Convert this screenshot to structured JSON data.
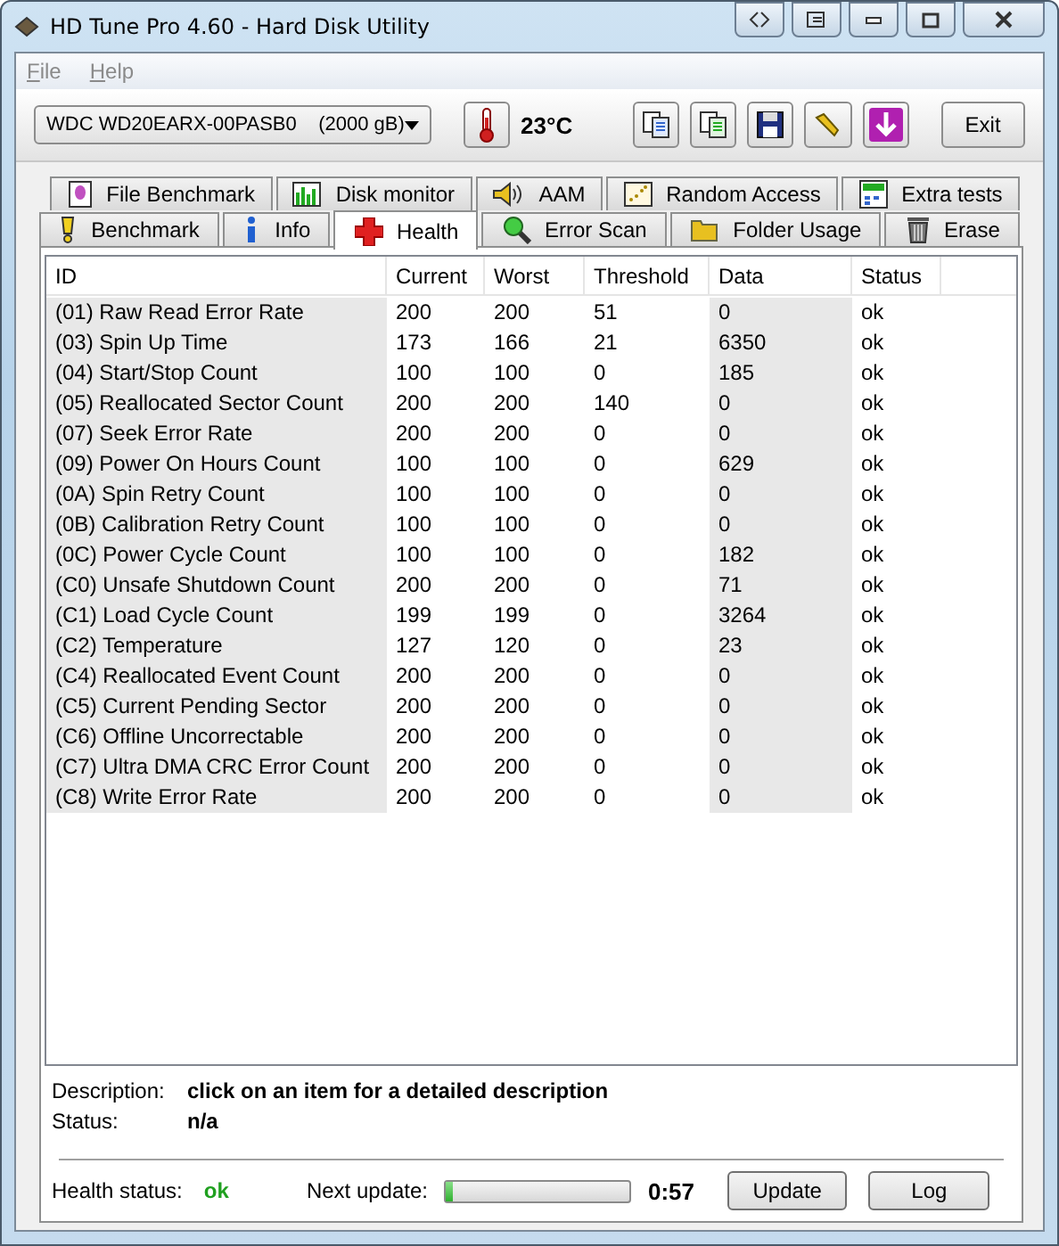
{
  "window": {
    "title": "HD Tune Pro 4.60 - Hard Disk Utility"
  },
  "menu": [
    {
      "label": "File"
    },
    {
      "label": "Help"
    }
  ],
  "toolbar": {
    "drive": "WDC WD20EARX-00PASB0    (2000 gB)",
    "temperature": "23°C",
    "exit": "Exit"
  },
  "tabs": [
    [
      {
        "label": "File Benchmark",
        "selected": false
      },
      {
        "label": "Disk monitor",
        "selected": false
      },
      {
        "label": "AAM",
        "selected": false
      },
      {
        "label": "Random Access",
        "selected": false
      },
      {
        "label": "Extra tests",
        "selected": false
      }
    ],
    [
      {
        "label": "Benchmark",
        "selected": false
      },
      {
        "label": "Info",
        "selected": false
      },
      {
        "label": "Health",
        "selected": true
      },
      {
        "label": "Error Scan",
        "selected": false
      },
      {
        "label": "Folder Usage",
        "selected": false
      },
      {
        "label": "Erase",
        "selected": false
      }
    ]
  ],
  "table": {
    "columns": [
      "ID",
      "Current",
      "Worst",
      "Threshold",
      "Data",
      "Status"
    ],
    "rows": [
      [
        "(01) Raw Read Error Rate",
        "200",
        "200",
        "51",
        "0",
        "ok"
      ],
      [
        "(03) Spin Up Time",
        "173",
        "166",
        "21",
        "6350",
        "ok"
      ],
      [
        "(04) Start/Stop Count",
        "100",
        "100",
        "0",
        "185",
        "ok"
      ],
      [
        "(05) Reallocated Sector Count",
        "200",
        "200",
        "140",
        "0",
        "ok"
      ],
      [
        "(07) Seek Error Rate",
        "200",
        "200",
        "0",
        "0",
        "ok"
      ],
      [
        "(09) Power On Hours Count",
        "100",
        "100",
        "0",
        "629",
        "ok"
      ],
      [
        "(0A) Spin Retry Count",
        "100",
        "100",
        "0",
        "0",
        "ok"
      ],
      [
        "(0B) Calibration Retry Count",
        "100",
        "100",
        "0",
        "0",
        "ok"
      ],
      [
        "(0C) Power Cycle Count",
        "100",
        "100",
        "0",
        "182",
        "ok"
      ],
      [
        "(C0) Unsafe Shutdown Count",
        "200",
        "200",
        "0",
        "71",
        "ok"
      ],
      [
        "(C1) Load Cycle Count",
        "199",
        "199",
        "0",
        "3264",
        "ok"
      ],
      [
        "(C2) Temperature",
        "127",
        "120",
        "0",
        "23",
        "ok"
      ],
      [
        "(C4) Reallocated Event Count",
        "200",
        "200",
        "0",
        "0",
        "ok"
      ],
      [
        "(C5) Current Pending Sector",
        "200",
        "200",
        "0",
        "0",
        "ok"
      ],
      [
        "(C6) Offline Uncorrectable",
        "200",
        "200",
        "0",
        "0",
        "ok"
      ],
      [
        "(C7) Ultra DMA CRC Error Count",
        "200",
        "200",
        "0",
        "0",
        "ok"
      ],
      [
        "(C8) Write Error Rate",
        "200",
        "200",
        "0",
        "0",
        "ok"
      ]
    ]
  },
  "details": {
    "description_label": "Description:",
    "description": "click on an item for a detailed description",
    "status_label": "Status:",
    "status": "n/a"
  },
  "footer": {
    "health_label": "Health status:",
    "health": "ok",
    "next_label": "Next update:",
    "progress": {
      "level": 0.04
    },
    "countdown": "0:57",
    "buttons": [
      "Update",
      "Log"
    ]
  }
}
